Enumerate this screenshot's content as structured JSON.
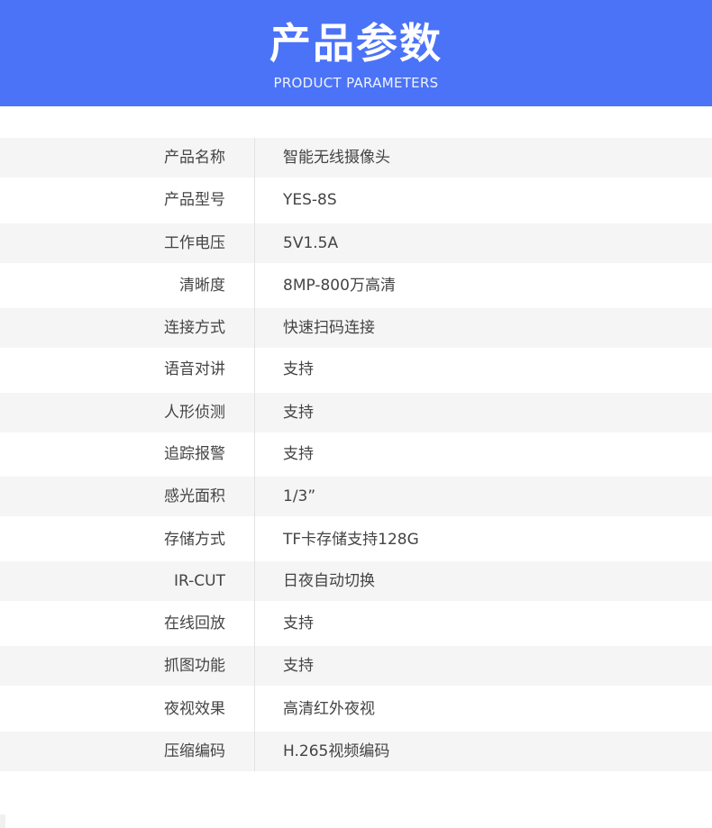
{
  "header": {
    "title": "产品参数",
    "subtitle": "PRODUCT PARAMETERS",
    "background_color": "#4b73f7"
  },
  "params": [
    {
      "label": "产品名称",
      "value": "智能无线摄像头"
    },
    {
      "label": "产品型号",
      "value": "YES-8S"
    },
    {
      "label": "工作电压",
      "value": "5V1.5A"
    },
    {
      "label": "清晰度",
      "value": "8MP-800万高清"
    },
    {
      "label": "连接方式",
      "value": "快速扫码连接"
    },
    {
      "label": "语音对讲",
      "value": "支持"
    },
    {
      "label": "人形侦测",
      "value": "支持"
    },
    {
      "label": "追踪报警",
      "value": "支持"
    },
    {
      "label": "感光面积",
      "value": "1/3”"
    },
    {
      "label": "存储方式",
      "value": "TF卡存储支持128G"
    },
    {
      "label": "IR-CUT",
      "value": "日夜自动切换"
    },
    {
      "label": "在线回放",
      "value": "支持"
    },
    {
      "label": "抓图功能",
      "value": "支持"
    },
    {
      "label": "夜视效果",
      "value": "高清红外夜视"
    },
    {
      "label": "压缩编码",
      "value": "H.265视频编码"
    }
  ]
}
